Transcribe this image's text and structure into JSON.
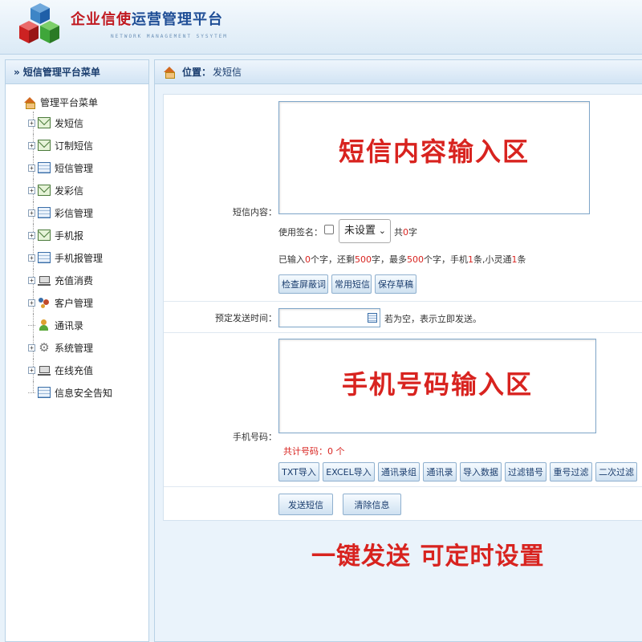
{
  "header": {
    "brand_red": "企业信使",
    "brand_blue": "运营管理平台",
    "tagline": "NETWORK MANAGEMENT SYSYTEM"
  },
  "sidebar": {
    "title": "» 短信管理平台菜单",
    "root": "管理平台菜单",
    "items": [
      {
        "label": "发短信",
        "icon": "mail-icon",
        "expander": "+"
      },
      {
        "label": "订制短信",
        "icon": "mail-icon",
        "expander": "+"
      },
      {
        "label": "短信管理",
        "icon": "table-icon",
        "expander": "+"
      },
      {
        "label": "发彩信",
        "icon": "mail-icon",
        "expander": "+"
      },
      {
        "label": "彩信管理",
        "icon": "table-icon",
        "expander": "+"
      },
      {
        "label": "手机报",
        "icon": "mail-icon",
        "expander": "+"
      },
      {
        "label": "手机报管理",
        "icon": "table-icon",
        "expander": "+"
      },
      {
        "label": "充值消费",
        "icon": "cart-icon",
        "expander": "+"
      },
      {
        "label": "客户管理",
        "icon": "users-icon",
        "expander": "+"
      },
      {
        "label": "通讯录",
        "icon": "user-icon",
        "expander": ""
      },
      {
        "label": "系统管理",
        "icon": "gear-icon",
        "expander": "+"
      },
      {
        "label": "在线充值",
        "icon": "cart-icon",
        "expander": "+"
      },
      {
        "label": "信息安全告知",
        "icon": "table-icon",
        "expander": ""
      }
    ]
  },
  "breadcrumb": {
    "prefix": "位置：",
    "current": "发短信"
  },
  "form": {
    "content_label": "短信内容：",
    "content_overlay": "短信内容输入区",
    "signature_label": "使用签名：",
    "signature_select": "未设置",
    "total_prefix": "共",
    "total_value": "0",
    "total_suffix": "字",
    "stats": {
      "t1": "已输入",
      "v1": "0",
      "t2": "个字，还剩",
      "v2": "500",
      "t3": "字，最多",
      "v3": "500",
      "t4": "个字，手机",
      "v4": "1",
      "t5": "条,小灵通",
      "v5": "1",
      "t6": "条"
    },
    "content_buttons": [
      "检查屏蔽词",
      "常用短信",
      "保存草稿"
    ],
    "schedule_label": "预定发送时间：",
    "schedule_hint": "若为空，表示立即发送。",
    "phone_label": "手机号码：",
    "phone_overlay": "手机号码输入区",
    "phone_count": "共计号码：0 个",
    "phone_buttons": [
      "TXT导入",
      "EXCEL导入",
      "通讯录组",
      "通讯录",
      "导入数据",
      "过滤错号",
      "重号过滤",
      "二次过滤"
    ],
    "send_button": "发送短信",
    "clear_button": "清除信息"
  },
  "promo": "一键发送 可定时设置"
}
